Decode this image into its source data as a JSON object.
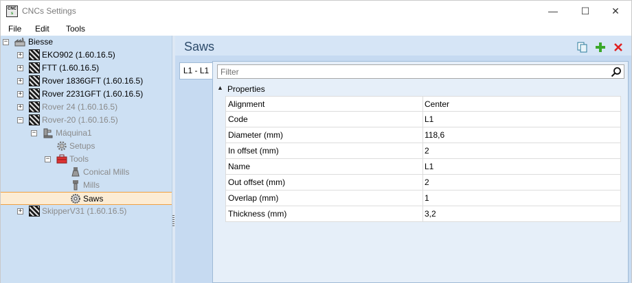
{
  "window": {
    "title": "CNCs Settings",
    "app_icon_text_top": "CNC",
    "app_icon_text_bottom": "s",
    "minimize_glyph": "—",
    "maximize_glyph": "☐",
    "close_glyph": "✕"
  },
  "menu": [
    "File",
    "Edit",
    "Tools"
  ],
  "tree": {
    "root": "Biesse",
    "items": [
      {
        "label": "EKO902 (1.60.16.5)",
        "state": "normal"
      },
      {
        "label": "FTT (1.60.16.5)",
        "state": "normal"
      },
      {
        "label": "Rover 1836GFT (1.60.16.5)",
        "state": "normal"
      },
      {
        "label": "Rover 2231GFT (1.60.16.5)",
        "state": "normal"
      },
      {
        "label": "Rover 24 (1.60.16.5)",
        "state": "disabled"
      },
      {
        "label": "Rover-20 (1.60.16.5)",
        "state": "disabled"
      },
      {
        "label": "Máquina1",
        "state": "disabled"
      },
      {
        "label": "Setups",
        "state": "disabled"
      },
      {
        "label": "Tools",
        "state": "disabled"
      },
      {
        "label": "Conical Mills",
        "state": "disabled"
      },
      {
        "label": "Mills",
        "state": "disabled"
      },
      {
        "label": "Saws",
        "state": "selected"
      },
      {
        "label": "SkipperV31 (1.60.16.5)",
        "state": "disabled"
      }
    ]
  },
  "content": {
    "title": "Saws",
    "tab_label": "L1 - L1",
    "filter_placeholder": "Filter",
    "section_label": "Properties",
    "properties": [
      {
        "name": "Alignment",
        "value": "Center"
      },
      {
        "name": "Code",
        "value": "L1"
      },
      {
        "name": "Diameter (mm)",
        "value": "118,6"
      },
      {
        "name": "In offset (mm)",
        "value": "2"
      },
      {
        "name": "Name",
        "value": "L1"
      },
      {
        "name": "Out offset (mm)",
        "value": "2"
      },
      {
        "name": "Overlap (mm)",
        "value": "1"
      },
      {
        "name": "Thickness (mm)",
        "value": "3,2"
      }
    ]
  },
  "colors": {
    "tree_background": "#cde0f3",
    "selection_fill": "#fcecd4",
    "selection_border": "#f0a040",
    "add_green": "#3aa82a",
    "delete_red": "#e02020"
  },
  "icons": {
    "copy": "copy-icon",
    "add": "add-icon",
    "delete": "delete-icon",
    "search": "search-icon",
    "expand": "expand-icon",
    "collapse": "collapse-icon"
  }
}
